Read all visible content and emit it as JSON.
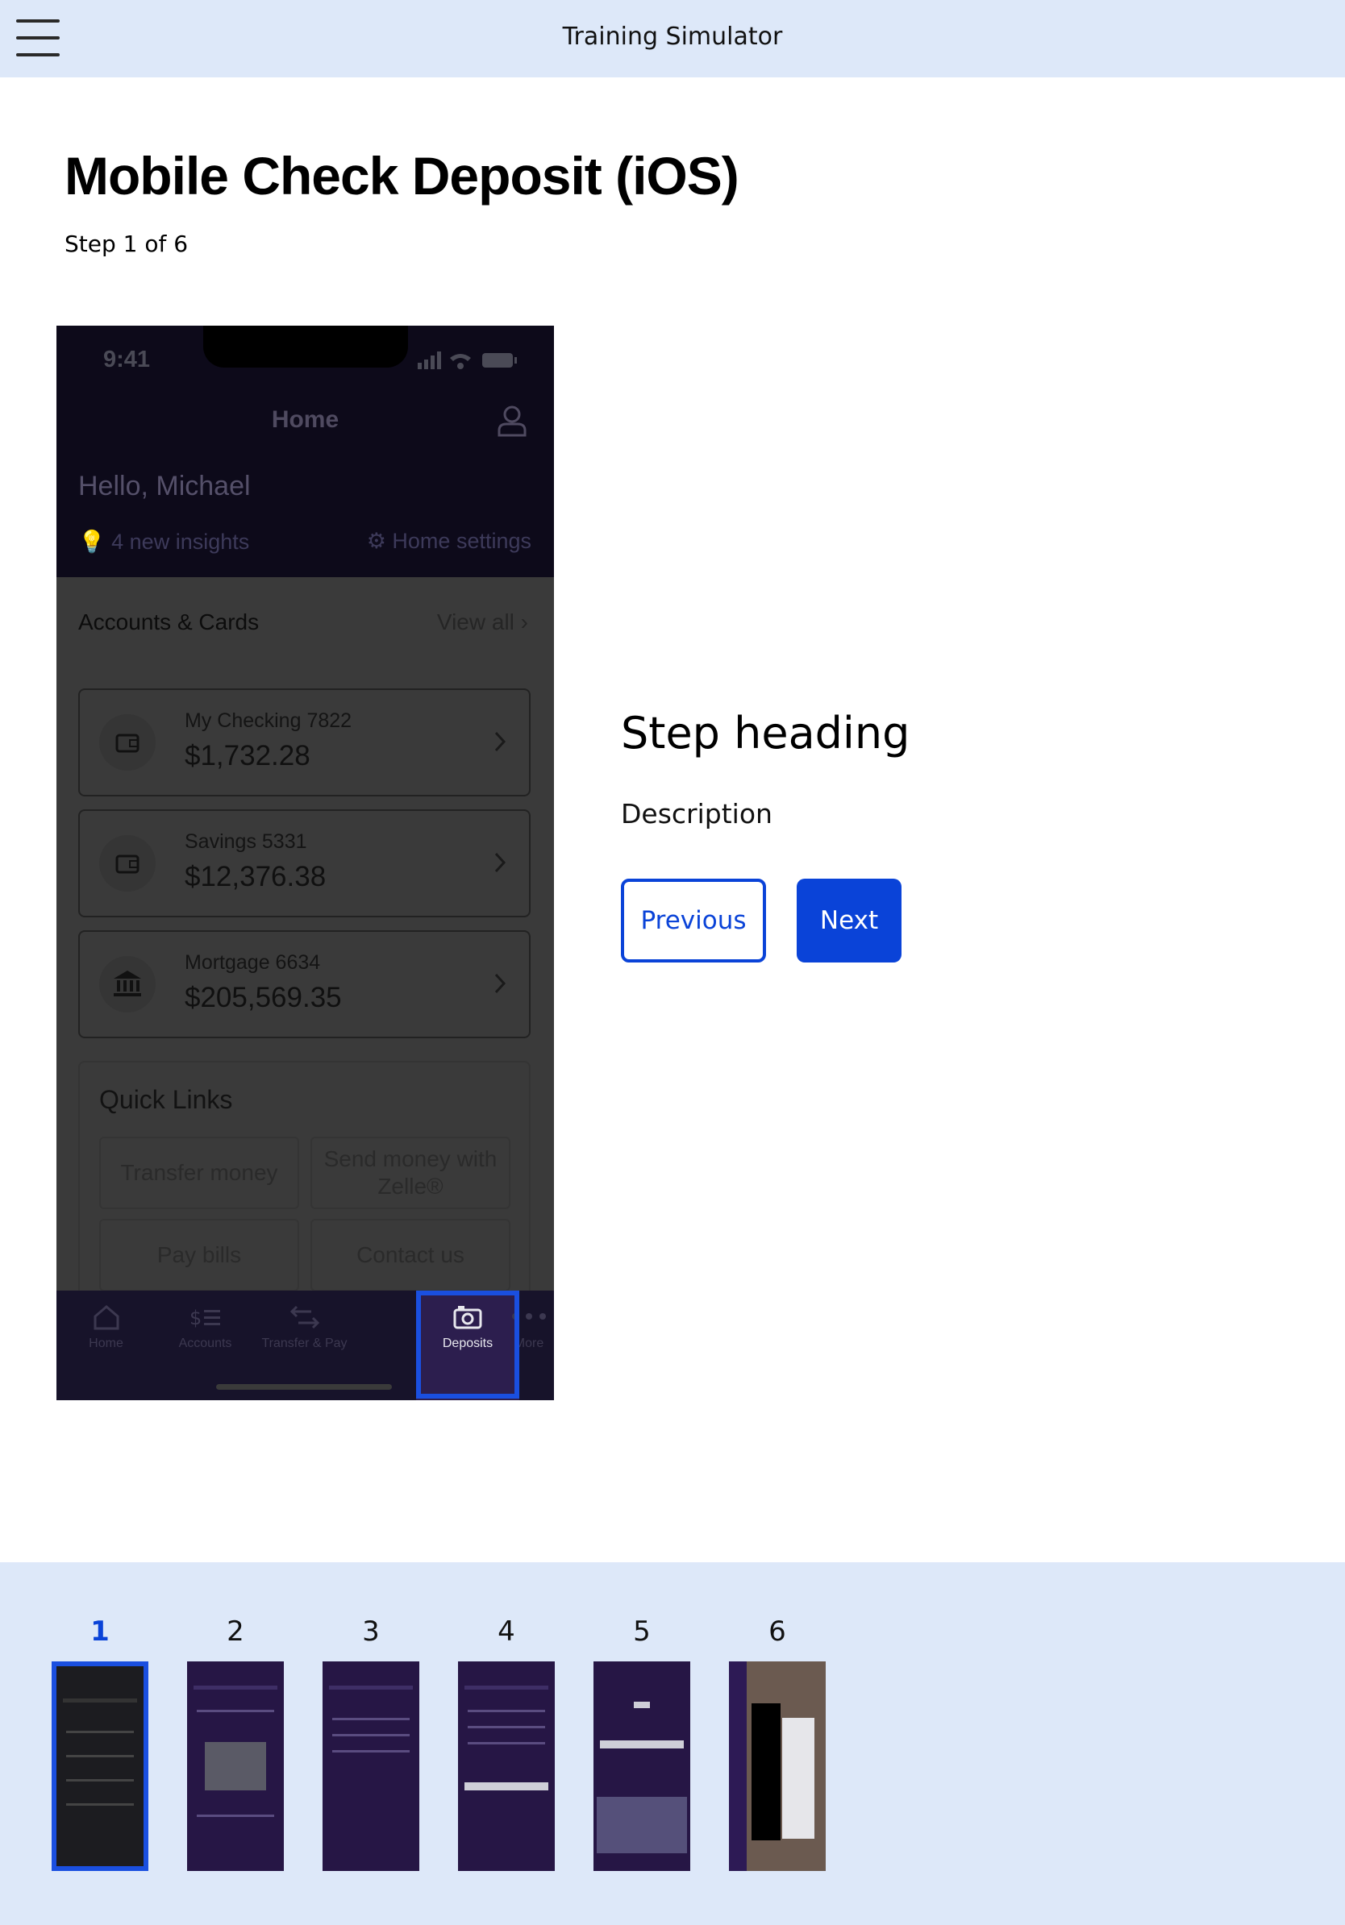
{
  "topbar": {
    "title": "Training Simulator"
  },
  "page": {
    "title": "Mobile Check Deposit (iOS)",
    "step_counter": "Step 1 of 6"
  },
  "phone": {
    "time": "9:41",
    "header_title": "Home",
    "greeting": "Hello, Michael",
    "insights": "4 new insights",
    "home_settings": "Home settings",
    "accounts_title": "Accounts & Cards",
    "view_all": "View all",
    "accounts": [
      {
        "name": "My Checking 7822",
        "balance": "$1,732.28",
        "icon": "wallet-icon"
      },
      {
        "name": "Savings 5331",
        "balance": "$12,376.38",
        "icon": "wallet-icon"
      },
      {
        "name": "Mortgage 6634",
        "balance": "$205,569.35",
        "icon": "bank-icon"
      }
    ],
    "quick_links_title": "Quick Links",
    "quick_links": [
      "Transfer money",
      "Send money with Zelle®",
      "Pay bills",
      "Contact us"
    ],
    "tabs": [
      {
        "label": "Home",
        "icon": "home-icon"
      },
      {
        "label": "Accounts",
        "icon": "accounts-icon"
      },
      {
        "label": "Transfer & Pay",
        "icon": "transfer-icon"
      },
      {
        "label": "Deposits",
        "icon": "camera-icon",
        "active": true
      },
      {
        "label": "More",
        "icon": "more-icon"
      }
    ]
  },
  "panel": {
    "heading": "Step heading",
    "description": "Description",
    "previous_label": "Previous",
    "next_label": "Next"
  },
  "steps": [
    "1",
    "2",
    "3",
    "4",
    "5",
    "6"
  ],
  "colors": {
    "accent": "#0a43d8",
    "topbar": "#dde8f9",
    "phone_purple": "#261645"
  }
}
